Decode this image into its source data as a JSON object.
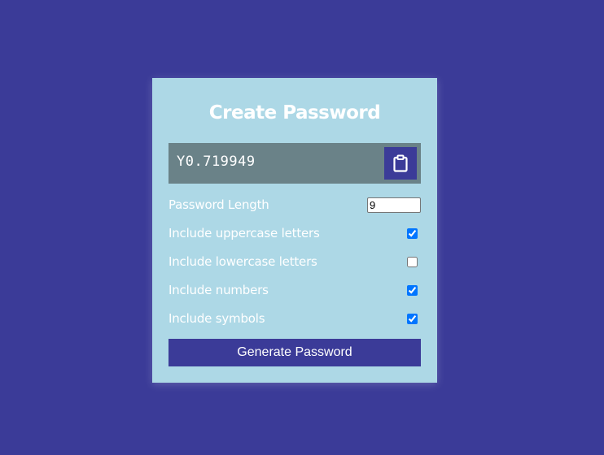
{
  "app": {
    "title": "Create Password"
  },
  "result": {
    "value": "Y0.719949",
    "copy_icon": "clipboard-icon"
  },
  "settings": {
    "length": {
      "label": "Password Length",
      "value": "9"
    },
    "options": [
      {
        "id": "uppercase",
        "label": "Include uppercase letters",
        "checked": true
      },
      {
        "id": "lowercase",
        "label": "Include lowercase letters",
        "checked": false
      },
      {
        "id": "numbers",
        "label": "Include numbers",
        "checked": true
      },
      {
        "id": "symbols",
        "label": "Include symbols",
        "checked": true
      }
    ]
  },
  "actions": {
    "generate_label": "Generate Password"
  },
  "colors": {
    "background": "#3b3b98",
    "card": "#add8e6",
    "result_bg": "#6a8288",
    "accent": "#3b3b98",
    "checkbox": "#0075ff"
  }
}
